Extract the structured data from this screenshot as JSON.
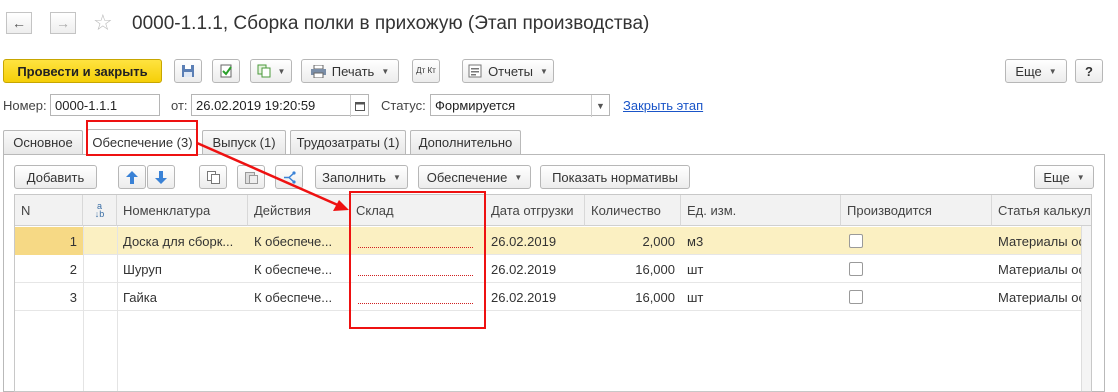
{
  "window": {
    "title": "0000-1.1.1, Сборка полки в прихожую (Этап производства)"
  },
  "toolbar": {
    "post_close": "Провести и закрыть",
    "print": "Печать",
    "dt_kt": "Дт Кт",
    "reports": "Отчеты",
    "more": "Еще",
    "help": "?"
  },
  "header": {
    "number_label": "Номер:",
    "number_value": "0000-1.1.1",
    "from_label": "от:",
    "date_value": "26.02.2019 19:20:59",
    "status_label": "Статус:",
    "status_value": "Формируется",
    "close_stage_link": "Закрыть этап"
  },
  "tabs": [
    {
      "label": "Основное"
    },
    {
      "label": "Обеспечение (3)"
    },
    {
      "label": "Выпуск (1)"
    },
    {
      "label": "Трудозатраты (1)"
    },
    {
      "label": "Дополнительно"
    }
  ],
  "table_toolbar": {
    "add": "Добавить",
    "fill": "Заполнить",
    "supply": "Обеспечение",
    "show_norms": "Показать нормативы",
    "more": "Еще"
  },
  "table": {
    "columns": [
      "N",
      "",
      "Номенклатура",
      "Действия",
      "Склад",
      "Дата отгрузки",
      "Количество",
      "Ед. изм.",
      "Производится",
      "Статья калькуля"
    ],
    "rows": [
      {
        "n": "1",
        "item": "Доска для сборк...",
        "action": "К обеспече...",
        "warehouse": "",
        "date": "26.02.2019",
        "qty": "2,000",
        "unit": "м3",
        "produced": false,
        "cost_item": "Материалы осно"
      },
      {
        "n": "2",
        "item": "Шуруп",
        "action": "К обеспече...",
        "warehouse": "",
        "date": "26.02.2019",
        "qty": "16,000",
        "unit": "шт",
        "produced": false,
        "cost_item": "Материалы осно"
      },
      {
        "n": "3",
        "item": "Гайка",
        "action": "К обеспече...",
        "warehouse": "",
        "date": "26.02.2019",
        "qty": "16,000",
        "unit": "шт",
        "produced": false,
        "cost_item": "Материалы осно"
      }
    ]
  },
  "colors": {
    "accent_yellow": "#f5cf08",
    "highlight_red": "#e11111",
    "selected_row": "#fbf0c2",
    "link": "#1a55c8"
  }
}
